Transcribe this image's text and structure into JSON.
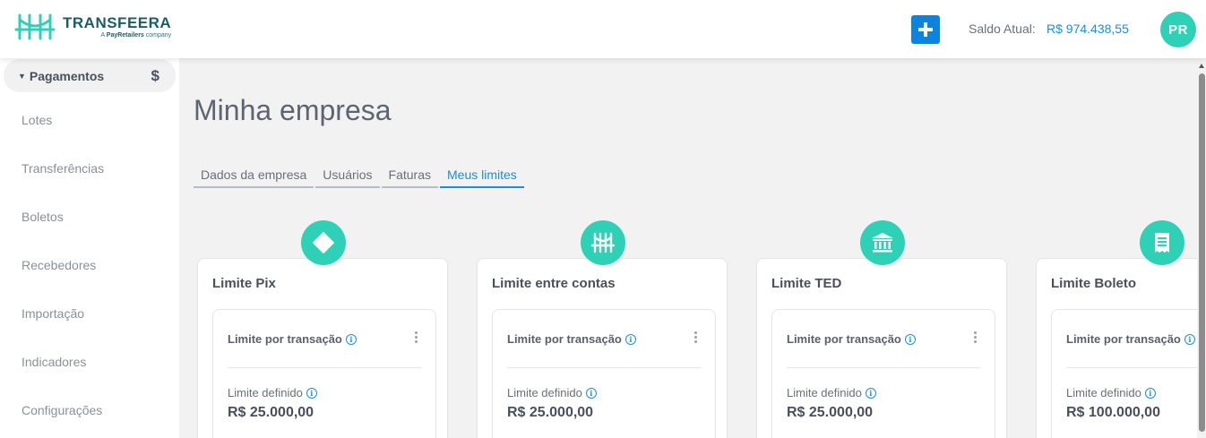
{
  "brand": {
    "name": "TRANSFEERA",
    "tagline_prefix": "A ",
    "tagline_brand": "PayRetailers",
    "tagline_suffix": " company",
    "accent": "#2ed1b5"
  },
  "header": {
    "add_icon": "plus-icon",
    "saldo_label": "Saldo Atual:",
    "saldo_value": "R$ 974.438,55",
    "avatar_initials": "PR"
  },
  "sidebar": {
    "group": {
      "label": "Pagamentos",
      "icon": "dollar-icon"
    },
    "items": [
      {
        "label": "Lotes"
      },
      {
        "label": "Transferências"
      },
      {
        "label": "Boletos"
      },
      {
        "label": "Recebedores"
      },
      {
        "label": "Importação"
      },
      {
        "label": "Indicadores"
      },
      {
        "label": "Configurações"
      }
    ]
  },
  "main": {
    "title": "Minha empresa",
    "tabs": [
      {
        "label": "Dados da empresa",
        "active": false
      },
      {
        "label": "Usuários",
        "active": false
      },
      {
        "label": "Faturas",
        "active": false
      },
      {
        "label": "Meus limites",
        "active": true
      }
    ],
    "cards": [
      {
        "title": "Limite Pix",
        "icon": "pix-icon",
        "per_transaction_label": "Limite por transação",
        "defined_label": "Limite definido",
        "defined_value": "R$ 25.000,00"
      },
      {
        "title": "Limite entre contas",
        "icon": "transfeera-icon",
        "per_transaction_label": "Limite por transação",
        "defined_label": "Limite definido",
        "defined_value": "R$ 25.000,00"
      },
      {
        "title": "Limite TED",
        "icon": "bank-icon",
        "per_transaction_label": "Limite por transação",
        "defined_label": "Limite definido",
        "defined_value": "R$ 25.000,00"
      },
      {
        "title": "Limite Boleto",
        "icon": "receipt-icon",
        "per_transaction_label": "Limite por transação",
        "defined_label": "Limite definido",
        "defined_value": "R$ 100.000,00"
      }
    ]
  }
}
